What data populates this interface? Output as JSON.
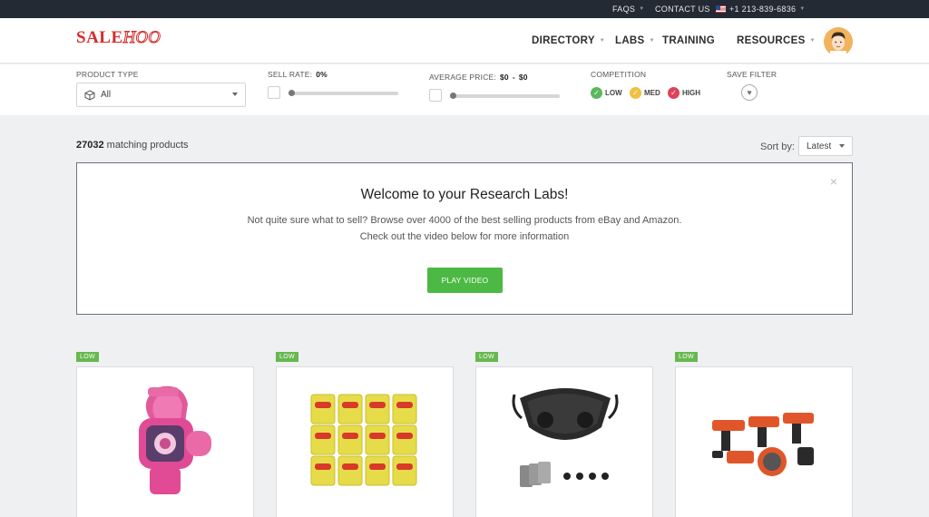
{
  "topbar": {
    "faqs": "FAQS",
    "contact": "CONTACT US",
    "phone": "+1 213-839-6836"
  },
  "header": {
    "logo_sale": "SALE",
    "logo_hoo": "HOO",
    "nav": [
      {
        "label": "DIRECTORY"
      },
      {
        "label": "LABS"
      },
      {
        "label": "TRAINING"
      },
      {
        "label": "RESOURCES"
      }
    ]
  },
  "filters": {
    "product_type_label": "PRODUCT TYPE",
    "product_type_value": "All",
    "sell_rate_label": "SELL RATE:",
    "sell_rate_value": "0%",
    "avg_price_label": "AVERAGE PRICE:",
    "avg_price_min": "$0",
    "avg_price_sep": "-",
    "avg_price_max": "$0",
    "competition_label": "COMPETITION",
    "competition": [
      {
        "label": "LOW",
        "color": "#5cb85c"
      },
      {
        "label": "MED",
        "color": "#f0c040"
      },
      {
        "label": "HIGH",
        "color": "#e0415a"
      }
    ],
    "save_filter_label": "SAVE FILTER"
  },
  "results": {
    "count": "27032",
    "count_suffix": "matching products",
    "sort_label": "Sort by:",
    "sort_value": "Latest"
  },
  "welcome": {
    "title": "Welcome to your Research Labs!",
    "line1": "Not quite sure what to sell? Browse over 4000 of the best selling products from eBay and Amazon.",
    "line2": "Check out the video below for more information",
    "button": "PLAY VIDEO",
    "close": "×"
  },
  "products": [
    {
      "badge": "LOW",
      "image": "kids-smartwatch-image"
    },
    {
      "badge": "LOW",
      "image": "play-doh-tubs-image"
    },
    {
      "badge": "LOW",
      "image": "face-mask-image"
    },
    {
      "badge": "LOW",
      "image": "power-tool-set-image"
    }
  ],
  "colors": {
    "brand": "#d62b2b",
    "topbar": "#232a34",
    "play_button": "#4cb944",
    "badge": "#67b84f"
  }
}
